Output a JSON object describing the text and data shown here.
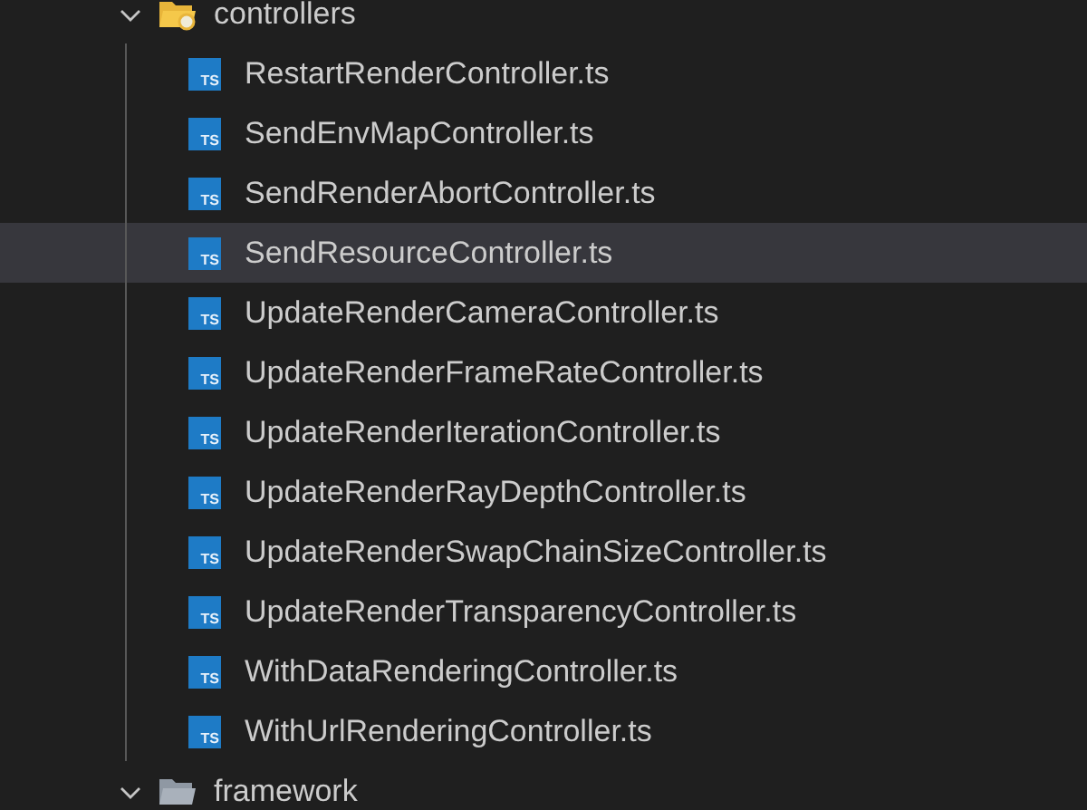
{
  "explorer": {
    "items": [
      {
        "kind": "folder",
        "name": "controllers",
        "expanded": true,
        "selected": false,
        "children": [
          {
            "kind": "ts",
            "badge": "TS",
            "name": "RestartRenderController.ts",
            "selected": false
          },
          {
            "kind": "ts",
            "badge": "TS",
            "name": "SendEnvMapController.ts",
            "selected": false
          },
          {
            "kind": "ts",
            "badge": "TS",
            "name": "SendRenderAbortController.ts",
            "selected": false
          },
          {
            "kind": "ts",
            "badge": "TS",
            "name": "SendResourceController.ts",
            "selected": true
          },
          {
            "kind": "ts",
            "badge": "TS",
            "name": "UpdateRenderCameraController.ts",
            "selected": false
          },
          {
            "kind": "ts",
            "badge": "TS",
            "name": "UpdateRenderFrameRateController.ts",
            "selected": false
          },
          {
            "kind": "ts",
            "badge": "TS",
            "name": "UpdateRenderIterationController.ts",
            "selected": false
          },
          {
            "kind": "ts",
            "badge": "TS",
            "name": "UpdateRenderRayDepthController.ts",
            "selected": false
          },
          {
            "kind": "ts",
            "badge": "TS",
            "name": "UpdateRenderSwapChainSizeController.ts",
            "selected": false
          },
          {
            "kind": "ts",
            "badge": "TS",
            "name": "UpdateRenderTransparencyController.ts",
            "selected": false
          },
          {
            "kind": "ts",
            "badge": "TS",
            "name": "WithDataRenderingController.ts",
            "selected": false
          },
          {
            "kind": "ts",
            "badge": "TS",
            "name": "WithUrlRenderingController.ts",
            "selected": false
          }
        ]
      },
      {
        "kind": "folder",
        "name": "framework",
        "expanded": true,
        "selected": false
      }
    ]
  }
}
